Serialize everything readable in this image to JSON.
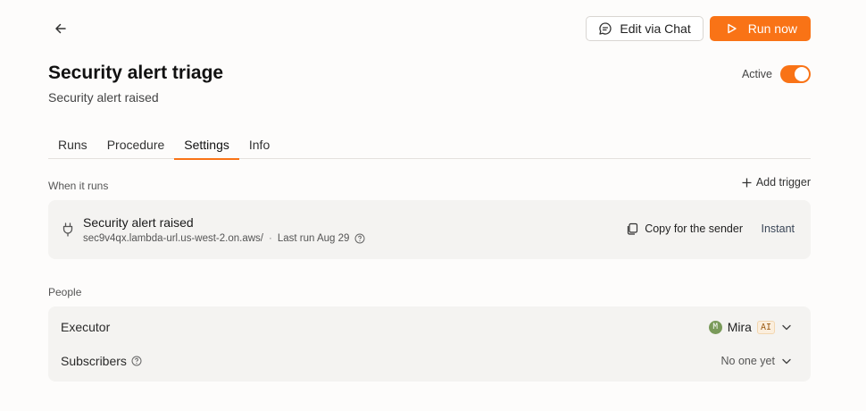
{
  "header": {
    "edit_chat_label": "Edit via Chat",
    "run_now_label": "Run now",
    "title": "Security alert triage",
    "subtitle": "Security alert raised",
    "active_label": "Active",
    "active_on": true
  },
  "tabs": [
    {
      "label": "Runs",
      "active": false
    },
    {
      "label": "Procedure",
      "active": false
    },
    {
      "label": "Settings",
      "active": true
    },
    {
      "label": "Info",
      "active": false
    }
  ],
  "when_it_runs": {
    "section_label": "When it runs",
    "add_trigger_label": "Add trigger",
    "trigger": {
      "name": "Security alert raised",
      "url": "sec9v4qx.lambda-url.us-west-2.on.aws/",
      "separator": "·",
      "last_run": "Last run Aug 29",
      "copy_label": "Copy for the sender",
      "mode": "Instant"
    }
  },
  "people": {
    "section_label": "People",
    "executor_label": "Executor",
    "executor": {
      "avatar_letter": "M",
      "name": "Mira",
      "badge": "AI"
    },
    "subscribers_label": "Subscribers",
    "subscribers_value": "No one yet"
  },
  "colors": {
    "accent": "#f97316",
    "background": "#fdfcfb",
    "card": "#f4f3f1"
  },
  "icons": [
    "back-arrow-icon",
    "chat-bubble-icon",
    "play-icon",
    "plus-icon",
    "plug-icon",
    "help-circle-icon",
    "copy-icon",
    "chevron-down-icon"
  ]
}
